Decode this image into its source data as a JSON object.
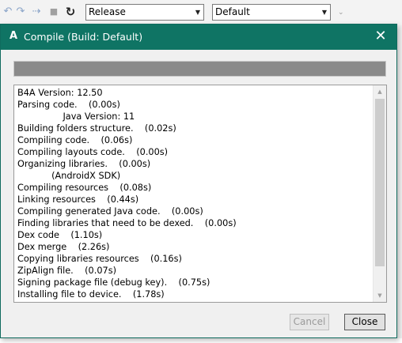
{
  "toolbar": {
    "icons": [
      "back-icon",
      "step-icon",
      "forward-icon",
      "stop-icon",
      "refresh-icon"
    ],
    "config_combo": "Release",
    "build_combo": "Default"
  },
  "dialog": {
    "app_icon_letter": "A",
    "title": "Compile (Build: Default)",
    "close_glyph": "✕",
    "progress_fraction": 1.0,
    "log_lines": [
      "B4A Version: 12.50",
      "Parsing code.    (0.00s)",
      "                Java Version: 11",
      "Building folders structure.    (0.02s)",
      "Compiling code.    (0.06s)",
      "Compiling layouts code.    (0.00s)",
      "Organizing libraries.    (0.00s)",
      "            (AndroidX SDK)",
      "Compiling resources    (0.08s)",
      "Linking resources    (0.44s)",
      "Compiling generated Java code.    (0.00s)",
      "Finding libraries that need to be dexed.    (0.00s)",
      "Dex code    (1.10s)",
      "Dex merge    (2.26s)",
      "Copying libraries resources    (0.16s)",
      "ZipAlign file.    (0.07s)",
      "Signing package file (debug key).    (0.75s)",
      "Installing file to device.    (1.78s)"
    ],
    "cancel_label": "Cancel",
    "close_label": "Close"
  },
  "colors": {
    "titlebar": "#0f7464",
    "progress": "#8a8a8a"
  }
}
